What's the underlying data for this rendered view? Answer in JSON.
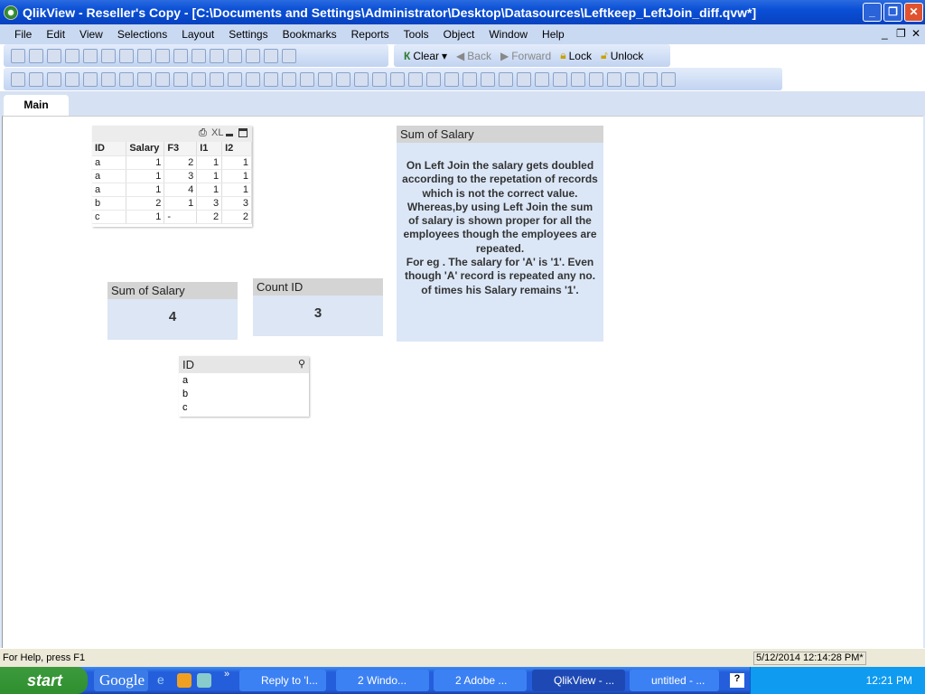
{
  "window": {
    "title": "QlikView - Reseller's Copy - [C:\\Documents and Settings\\Administrator\\Desktop\\Datasources\\Leftkeep_LeftJoin_diff.qvw*]"
  },
  "menu": [
    "File",
    "Edit",
    "View",
    "Selections",
    "Layout",
    "Settings",
    "Bookmarks",
    "Reports",
    "Tools",
    "Object",
    "Window",
    "Help"
  ],
  "toolbar1_icons": [
    "new-icon",
    "open-icon",
    "reload-icon",
    "save-icon",
    "print-icon",
    "edit-script-icon",
    "reload-data-icon",
    "undo-icon",
    "redo-icon",
    "search-icon",
    "check-icon",
    "chart-icon",
    "bookmark-star-icon",
    "edit-icon",
    "help-icon",
    "context-help-icon"
  ],
  "nav": {
    "clear": "Clear",
    "back": "Back",
    "forward": "Forward",
    "lock": "Lock",
    "unlock": "Unlock"
  },
  "toolbar2_icons": [
    "new-sheet-icon",
    "prev-sheet-icon",
    "next-sheet-icon",
    "sheet-props-icon",
    "listbox-icon",
    "statistics-icon",
    "table-box-icon",
    "multibox-icon",
    "chart-icon",
    "input-box-icon",
    "current-selections-icon",
    "button-icon",
    "text-object-icon",
    "line-arrow-icon",
    "slider-icon",
    "bookmark-object-icon",
    "search-object-icon",
    "container-icon",
    "custom-object-icon",
    "chart-wizard-icon",
    "format-painter-icon",
    "grid-icon",
    "align-left-icon",
    "align-center-icon",
    "align-right-icon",
    "align-bottom-icon",
    "space-horiz-icon",
    "space-vert-icon",
    "align-top-icon",
    "align-middle-icon",
    "space-icon",
    "distribute-icon",
    "user-icon",
    "properties-icon",
    "edit2-icon",
    "share-icon",
    "doc-icon"
  ],
  "tabs": [
    "Main"
  ],
  "tablebox": {
    "caption_icons": [
      "print-icon",
      "xl-icon",
      "minimize-icon",
      "maximize-icon"
    ],
    "xl": "XL",
    "columns": [
      "ID",
      "Salary",
      "F3",
      "I1",
      "I2"
    ],
    "rows": [
      [
        "a",
        "1",
        "2",
        "1",
        "1"
      ],
      [
        "a",
        "1",
        "3",
        "1",
        "1"
      ],
      [
        "a",
        "1",
        "4",
        "1",
        "1"
      ],
      [
        "b",
        "2",
        "1",
        "3",
        "3"
      ],
      [
        "c",
        "1",
        "-",
        "2",
        "2"
      ]
    ]
  },
  "textbox": {
    "caption": "Sum of Salary",
    "body": "On Left Join the salary gets doubled according to the repetation of records which is not the correct value. Whereas,by using Left Join the sum of salary is shown proper for all the employees though the employees are repeated.\nFor eg . The salary for 'A' is '1'. Even though 'A' record is repeated any no. of times his Salary remains '1'."
  },
  "kpi_sum": {
    "caption": "Sum of Salary",
    "value": "4"
  },
  "kpi_count": {
    "caption": "Count ID",
    "value": "3"
  },
  "listbox": {
    "caption": "ID",
    "items": [
      "a",
      "b",
      "c"
    ]
  },
  "status": {
    "help": "For Help, press F1",
    "datetime": "5/12/2014 12:14:28 PM*"
  },
  "taskbar": {
    "start": "start",
    "google": "Google",
    "tasks": [
      "Reply to 'I...",
      "2 Windo...",
      "2 Adobe ...",
      "QlikView - ...",
      "untitled - ..."
    ],
    "clock": "12:21 PM"
  },
  "colors": {
    "titlebar": "#0a4fd6",
    "object_body": "#dce6f5",
    "caption": "#d4d4d4"
  }
}
